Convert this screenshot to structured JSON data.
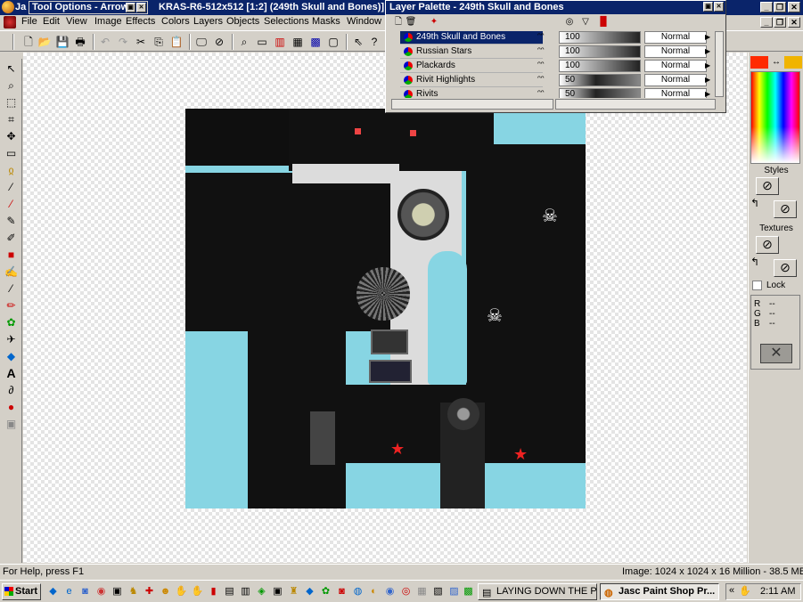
{
  "titlebar": {
    "prefix": "Ja",
    "title": "KRAS-R6-512x512 [1:2] (249th Skull and Bones)]"
  },
  "tool_options": {
    "title": "Tool Options - Arrow"
  },
  "menu": [
    "File",
    "Edit",
    "View",
    "Image",
    "Effects",
    "Colors",
    "Layers",
    "Objects",
    "Selections",
    "Masks",
    "Window"
  ],
  "layer_palette": {
    "title": "Layer Palette - 249th Skull and Bones",
    "layers": [
      {
        "name": "249th Skull and Bones",
        "opacity": "100",
        "blend": "Normal",
        "selected": true
      },
      {
        "name": "Russian Stars",
        "opacity": "100",
        "blend": "Normal",
        "selected": false
      },
      {
        "name": "Plackards",
        "opacity": "100",
        "blend": "Normal",
        "selected": false
      },
      {
        "name": "Rivit Highlights",
        "opacity": "50",
        "blend": "Normal",
        "selected": false
      },
      {
        "name": "Rivits",
        "opacity": "50",
        "blend": "Normal",
        "selected": false
      }
    ]
  },
  "right_palette": {
    "styles_label": "Styles",
    "textures_label": "Textures",
    "lock_label": "Lock",
    "rgb": {
      "r": "R",
      "g": "G",
      "b": "B",
      "r_val": "--",
      "g_val": "--",
      "b_val": "--"
    },
    "fg_color": "#ff2a00",
    "bg_color": "#f0b400"
  },
  "statusbar": {
    "help": "For Help, press F1",
    "image_info": "Image:  1024 x 1024 x 16 Million - 38.5 MBytes"
  },
  "taskbar": {
    "start": "Start",
    "tasks": [
      {
        "label": "LAYING DOWN THE P...",
        "active": false
      },
      {
        "label": "Jasc Paint Shop Pr...",
        "active": true
      }
    ],
    "clock": "2:11 AM"
  }
}
